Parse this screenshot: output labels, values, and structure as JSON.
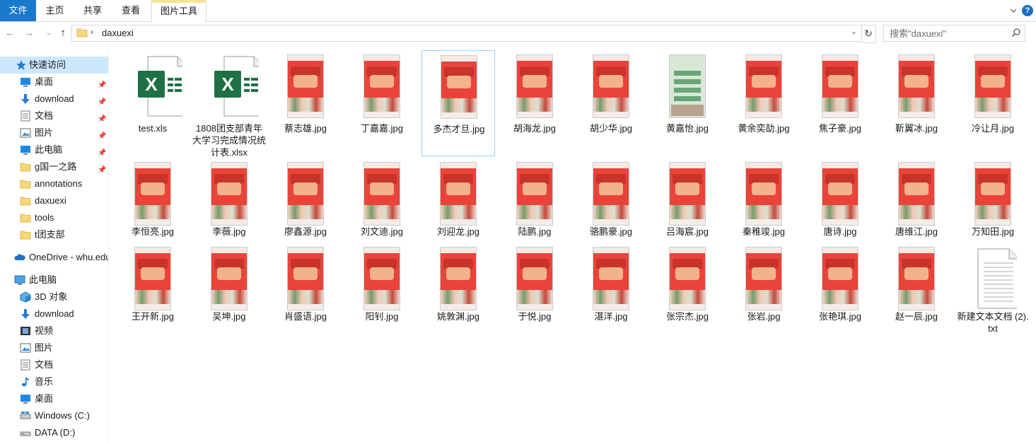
{
  "ribbon": {
    "tabs": {
      "file": "文件",
      "home": "主页",
      "share": "共享",
      "view": "查看",
      "picture_tools": "图片工具"
    },
    "help": "?"
  },
  "address": {
    "separator": "›",
    "path": "daxuexi",
    "search_placeholder": "搜索\"daxuexi\""
  },
  "sidebar": {
    "quick_access": "快速访问",
    "items": [
      {
        "label": "桌面",
        "icon": "desktop-icon",
        "pinned": true
      },
      {
        "label": "download",
        "icon": "download-icon",
        "pinned": true
      },
      {
        "label": "文档",
        "icon": "document-icon",
        "pinned": true
      },
      {
        "label": "图片",
        "icon": "pictures-icon",
        "pinned": true
      },
      {
        "label": "此电脑",
        "icon": "pc-icon",
        "pinned": true
      },
      {
        "label": "g国一之路",
        "icon": "folder-icon",
        "pinned": true
      },
      {
        "label": "annotations",
        "icon": "folder-icon",
        "pinned": false
      },
      {
        "label": "daxuexi",
        "icon": "folder-icon",
        "pinned": false
      },
      {
        "label": "tools",
        "icon": "folder-icon",
        "pinned": false
      },
      {
        "label": "t团支部",
        "icon": "folder-icon",
        "pinned": false
      }
    ],
    "onedrive": "OneDrive - whu.edu",
    "this_pc": "此电脑",
    "pc_items": [
      {
        "label": "3D 对象",
        "icon": "3d-objects-icon"
      },
      {
        "label": "download",
        "icon": "download-icon"
      },
      {
        "label": "视频",
        "icon": "videos-icon"
      },
      {
        "label": "图片",
        "icon": "pictures-icon"
      },
      {
        "label": "文档",
        "icon": "document-icon"
      },
      {
        "label": "音乐",
        "icon": "music-icon"
      },
      {
        "label": "桌面",
        "icon": "desktop-icon"
      },
      {
        "label": "Windows (C:)",
        "icon": "drive-icon"
      },
      {
        "label": "DATA (D:)",
        "icon": "drive-icon"
      }
    ]
  },
  "files": [
    {
      "name": "test.xls",
      "type": "excel"
    },
    {
      "name": "1808团支部青年大学习完成情况统计表.xlsx",
      "type": "excel"
    },
    {
      "name": "蔡志雄.jpg",
      "type": "red"
    },
    {
      "name": "丁嘉嘉.jpg",
      "type": "red"
    },
    {
      "name": "多杰才旦.jpg",
      "type": "red",
      "selected": true
    },
    {
      "name": "胡海龙.jpg",
      "type": "red"
    },
    {
      "name": "胡少华.jpg",
      "type": "red"
    },
    {
      "name": "黄嘉怡.jpg",
      "type": "green"
    },
    {
      "name": "黄余奕劼.jpg",
      "type": "red"
    },
    {
      "name": "焦子豪.jpg",
      "type": "red"
    },
    {
      "name": "靳翼冰.jpg",
      "type": "red"
    },
    {
      "name": "冷让月.jpg",
      "type": "red"
    },
    {
      "name": "李恒亮.jpg",
      "type": "red"
    },
    {
      "name": "李薇.jpg",
      "type": "red"
    },
    {
      "name": "廖鑫源.jpg",
      "type": "red"
    },
    {
      "name": "刘文迪.jpg",
      "type": "red"
    },
    {
      "name": "刘迎龙.jpg",
      "type": "red"
    },
    {
      "name": "陆鹏.jpg",
      "type": "red"
    },
    {
      "name": "骆鹏豪.jpg",
      "type": "red"
    },
    {
      "name": "吕海宸.jpg",
      "type": "red"
    },
    {
      "name": "秦稚竣.jpg",
      "type": "red"
    },
    {
      "name": "唐诗.jpg",
      "type": "red"
    },
    {
      "name": "唐维江.jpg",
      "type": "red"
    },
    {
      "name": "万知田.jpg",
      "type": "red"
    },
    {
      "name": "王开新.jpg",
      "type": "red"
    },
    {
      "name": "吴坤.jpg",
      "type": "red"
    },
    {
      "name": "肖盛语.jpg",
      "type": "red"
    },
    {
      "name": "阳钊.jpg",
      "type": "red"
    },
    {
      "name": "姚敦渊.jpg",
      "type": "red"
    },
    {
      "name": "于悦.jpg",
      "type": "red"
    },
    {
      "name": "湛洋.jpg",
      "type": "red"
    },
    {
      "name": "张宗杰.jpg",
      "type": "red"
    },
    {
      "name": "张岩.jpg",
      "type": "red"
    },
    {
      "name": "张艳琪.jpg",
      "type": "red"
    },
    {
      "name": "赵一辰.jpg",
      "type": "red"
    },
    {
      "name": "新建文本文档 (2).txt",
      "type": "text"
    }
  ],
  "colors": {
    "file_tab": "#1979ca",
    "selection": "#cce8ff",
    "excel_green": "#1e7145"
  }
}
